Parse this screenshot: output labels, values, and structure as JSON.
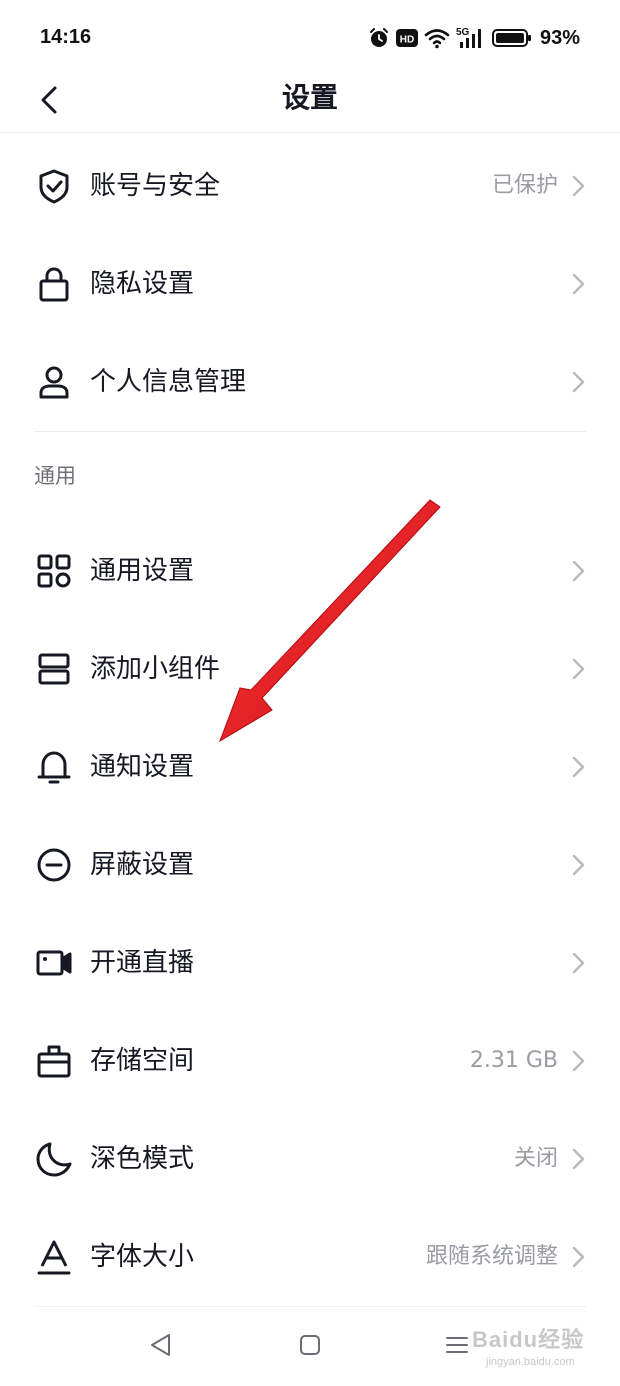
{
  "status_bar": {
    "time": "14:16",
    "network": "5G",
    "hd_badge": "HD",
    "battery": "93%"
  },
  "header": {
    "title": "设置"
  },
  "account_section": {
    "items": [
      {
        "label": "账号与安全",
        "value": "已保护",
        "icon": "shield-check-icon"
      },
      {
        "label": "隐私设置",
        "value": "",
        "icon": "lock-icon"
      },
      {
        "label": "个人信息管理",
        "value": "",
        "icon": "person-icon"
      }
    ]
  },
  "general_section": {
    "title": "通用",
    "items": [
      {
        "label": "通用设置",
        "value": "",
        "icon": "grid-icon"
      },
      {
        "label": "添加小组件",
        "value": "",
        "icon": "widget-icon"
      },
      {
        "label": "通知设置",
        "value": "",
        "icon": "bell-icon"
      },
      {
        "label": "屏蔽设置",
        "value": "",
        "icon": "minus-circle-icon"
      },
      {
        "label": "开通直播",
        "value": "",
        "icon": "video-camera-icon"
      },
      {
        "label": "存储空间",
        "value": "2.31 GB",
        "icon": "storage-box-icon"
      },
      {
        "label": "深色模式",
        "value": "关闭",
        "icon": "moon-icon"
      },
      {
        "label": "字体大小",
        "value": "跟随系统调整",
        "icon": "font-size-icon"
      }
    ]
  },
  "watermark": {
    "text": "Baidu经验",
    "sub": "jingyan.baidu.com"
  },
  "colors": {
    "text_primary": "#161823",
    "text_secondary": "#9a9ca3",
    "arrow": "#e8141b"
  }
}
